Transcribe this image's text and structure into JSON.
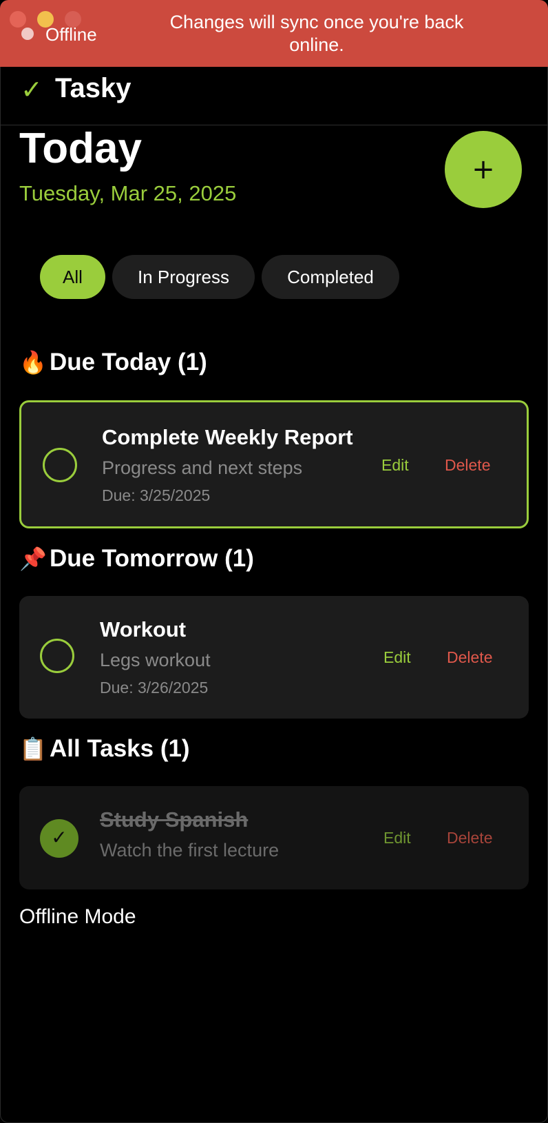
{
  "banner": {
    "status_label": "Offline",
    "message": "Changes will sync once you're back online."
  },
  "header": {
    "logo_glyph": "✓",
    "app_name": "Tasky"
  },
  "today": {
    "title": "Today",
    "date": "Tuesday, Mar 25, 2025",
    "add_glyph": "+"
  },
  "filters": [
    {
      "label": "All",
      "active": true
    },
    {
      "label": "In Progress",
      "active": false
    },
    {
      "label": "Completed",
      "active": false
    }
  ],
  "sections": [
    {
      "emoji": "🔥",
      "title": "Due Today (1)",
      "tasks": [
        {
          "title": "Complete Weekly Report",
          "description": "Progress and next steps",
          "due": "Due: 3/25/2025",
          "completed": false,
          "edit_label": "Edit",
          "delete_label": "Delete"
        }
      ]
    },
    {
      "emoji": "📌",
      "title": "Due Tomorrow (1)",
      "tasks": [
        {
          "title": "Workout",
          "description": "Legs workout",
          "due": "Due: 3/26/2025",
          "completed": false,
          "edit_label": "Edit",
          "delete_label": "Delete"
        }
      ]
    },
    {
      "emoji": "📋",
      "title": "All Tasks (1)",
      "tasks": [
        {
          "title": "Study Spanish",
          "description": "Watch the first lecture",
          "completed": true,
          "check_glyph": "✓",
          "edit_label": "Edit",
          "delete_label": "Delete"
        }
      ]
    }
  ],
  "footer": {
    "status": "Offline Mode"
  },
  "colors": {
    "accent": "#9acd3c",
    "banner": "#cc4a3e",
    "delete": "#e0584b",
    "card": "#1c1c1c",
    "background": "#000000"
  },
  "icons": {
    "logo": "checkmark-icon",
    "add": "plus-icon",
    "due_today": "fire-icon",
    "due_tomorrow": "pushpin-icon",
    "all_tasks": "clipboard-icon"
  }
}
